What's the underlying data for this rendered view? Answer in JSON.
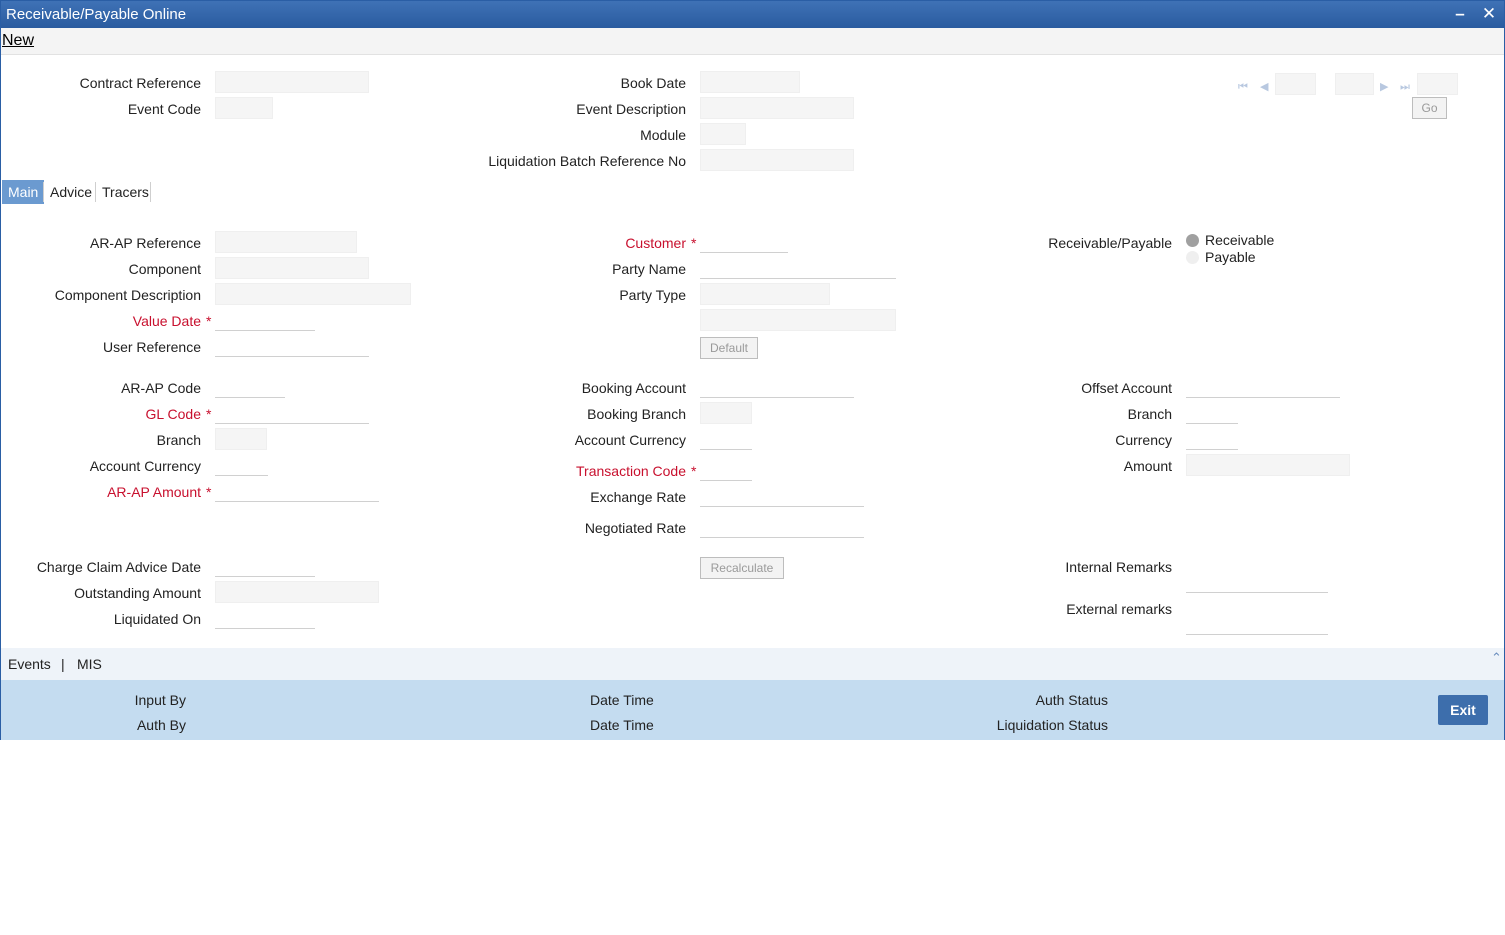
{
  "window": {
    "title": "Receivable/Payable Online",
    "minimize_glyph": "–",
    "close_glyph": "✕"
  },
  "menu": {
    "new_label": "New"
  },
  "header": {
    "contract_reference": "Contract Reference",
    "event_code": "Event Code",
    "book_date": "Book Date",
    "event_description": "Event Description",
    "module": "Module",
    "liquidation_batch_reference_no": "Liquidation Batch Reference No",
    "go_label": "Go"
  },
  "tabs": [
    {
      "label": "Main",
      "active": true
    },
    {
      "label": "Advice",
      "active": false
    },
    {
      "label": "Tracers",
      "active": false
    }
  ],
  "main": {
    "ar_ap_reference": "AR-AP Reference",
    "component": "Component",
    "component_description": "Component Description",
    "value_date": "Value Date",
    "user_reference": "User Reference",
    "customer": "Customer",
    "party_name": "Party Name",
    "party_type": "Party Type",
    "default_label": "Default",
    "receivable_payable": "Receivable/Payable",
    "receivable": "Receivable",
    "payable": "Payable",
    "ar_ap_code": "AR-AP Code",
    "gl_code": "GL Code",
    "branch": "Branch",
    "account_currency": "Account Currency",
    "ar_ap_amount": "AR-AP Amount",
    "booking_account": "Booking Account",
    "booking_branch": "Booking Branch",
    "booking_account_currency": "Account Currency",
    "transaction_code": "Transaction Code",
    "exchange_rate": "Exchange Rate",
    "negotiated_rate": "Negotiated Rate",
    "offset_account": "Offset Account",
    "offset_branch": "Branch",
    "currency": "Currency",
    "amount": "Amount",
    "charge_claim_advice_date": "Charge Claim Advice Date",
    "outstanding_amount": "Outstanding Amount",
    "liquidated_on": "Liquidated On",
    "recalculate_label": "Recalculate",
    "internal_remarks": "Internal Remarks",
    "external_remarks": "External remarks",
    "required_marker": "*"
  },
  "footer": {
    "events_label": "Events",
    "separator": "|",
    "mis_label": "MIS",
    "input_by": "Input By",
    "auth_by": "Auth By",
    "date_time_1": "Date Time",
    "date_time_2": "Date Time",
    "auth_status": "Auth Status",
    "liquidation_status": "Liquidation Status",
    "exit_label": "Exit"
  },
  "colors": {
    "title_bar": "#2a5b9f",
    "required": "#c8102e",
    "active_tab": "#6b9ad0",
    "audit_panel": "#c4dcf0",
    "exit_button": "#3d6eac"
  },
  "icons": {
    "first": "⏮",
    "prev": "◀",
    "next": "▶",
    "last": "⏭",
    "scroll_up": "⌃"
  }
}
